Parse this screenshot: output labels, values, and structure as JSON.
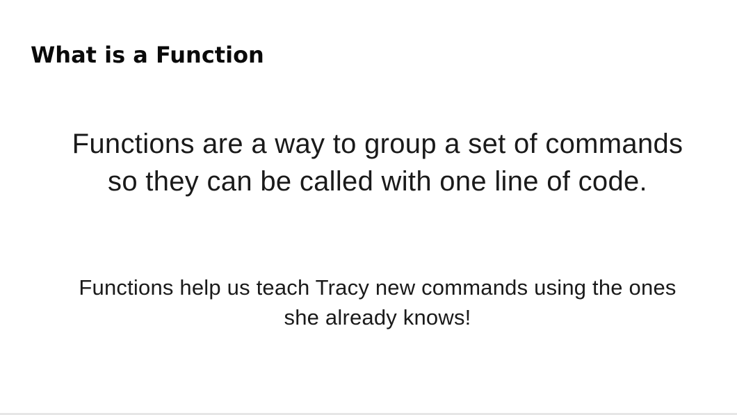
{
  "slide": {
    "title": "What is a Function",
    "main_text": "Functions are a way to group a set of commands so they can be called with one line of code.",
    "sub_text": "Functions help us teach Tracy new commands using the ones she already knows!"
  }
}
